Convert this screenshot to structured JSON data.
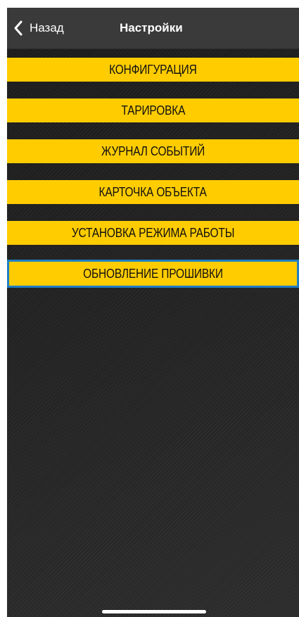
{
  "navbar": {
    "back_label": "Назад",
    "title": "Настройки"
  },
  "menu": {
    "items": [
      {
        "label": "КОНФИГУРАЦИЯ"
      },
      {
        "label": "ТАРИРОВКА"
      },
      {
        "label": "ЖУРНАЛ СОБЫТИЙ"
      },
      {
        "label": "КАРТОЧКА ОБЪЕКТА"
      },
      {
        "label": "УСТАНОВКА РЕЖИМА РАБОТЫ"
      },
      {
        "label": "ОБНОВЛЕНИЕ ПРОШИВКИ"
      }
    ],
    "focused_item": "ОБНОВЛЕНИЕ ПРОШИВКИ"
  },
  "colors": {
    "accent_yellow": "#ffcc00",
    "focus_ring": "#1f7fc4",
    "navbar": "#3a3a3a",
    "background": "#1e1e1e"
  },
  "icons": {
    "back": "chevron-left-icon"
  }
}
